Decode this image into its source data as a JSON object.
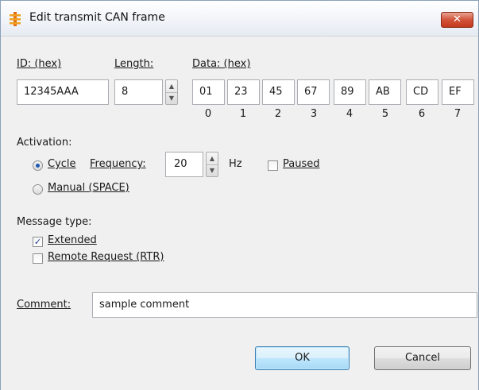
{
  "window": {
    "title": "Edit transmit CAN frame",
    "close_glyph": "✕"
  },
  "frame": {
    "id_label": "ID: (hex)",
    "length_label": "Length:",
    "data_label": "Data: (hex)",
    "id_value": "12345AAA",
    "length_value": "8",
    "data_bytes": [
      "01",
      "23",
      "45",
      "67",
      "89",
      "AB",
      "CD",
      "EF"
    ],
    "byte_indices": [
      "0",
      "1",
      "2",
      "3",
      "4",
      "5",
      "6",
      "7"
    ]
  },
  "activation": {
    "heading": "Activation:",
    "cycle_label": "Cycle",
    "frequency_label": "Frequency:",
    "frequency_value": "20",
    "hz_label": "Hz",
    "paused_label": "Paused",
    "paused_checked": false,
    "manual_label": "Manual (SPACE)",
    "selected": "cycle"
  },
  "message_type": {
    "heading": "Message type:",
    "extended_label": "Extended",
    "extended_checked": true,
    "rtr_label": "Remote Request (RTR)",
    "rtr_checked": false
  },
  "comment": {
    "label": "Comment:",
    "value": "sample comment"
  },
  "buttons": {
    "ok": "OK",
    "cancel": "Cancel"
  },
  "icons": {
    "app": "can-frame-icon",
    "spin_up": "▲",
    "spin_down": "▼",
    "check": "✓"
  }
}
